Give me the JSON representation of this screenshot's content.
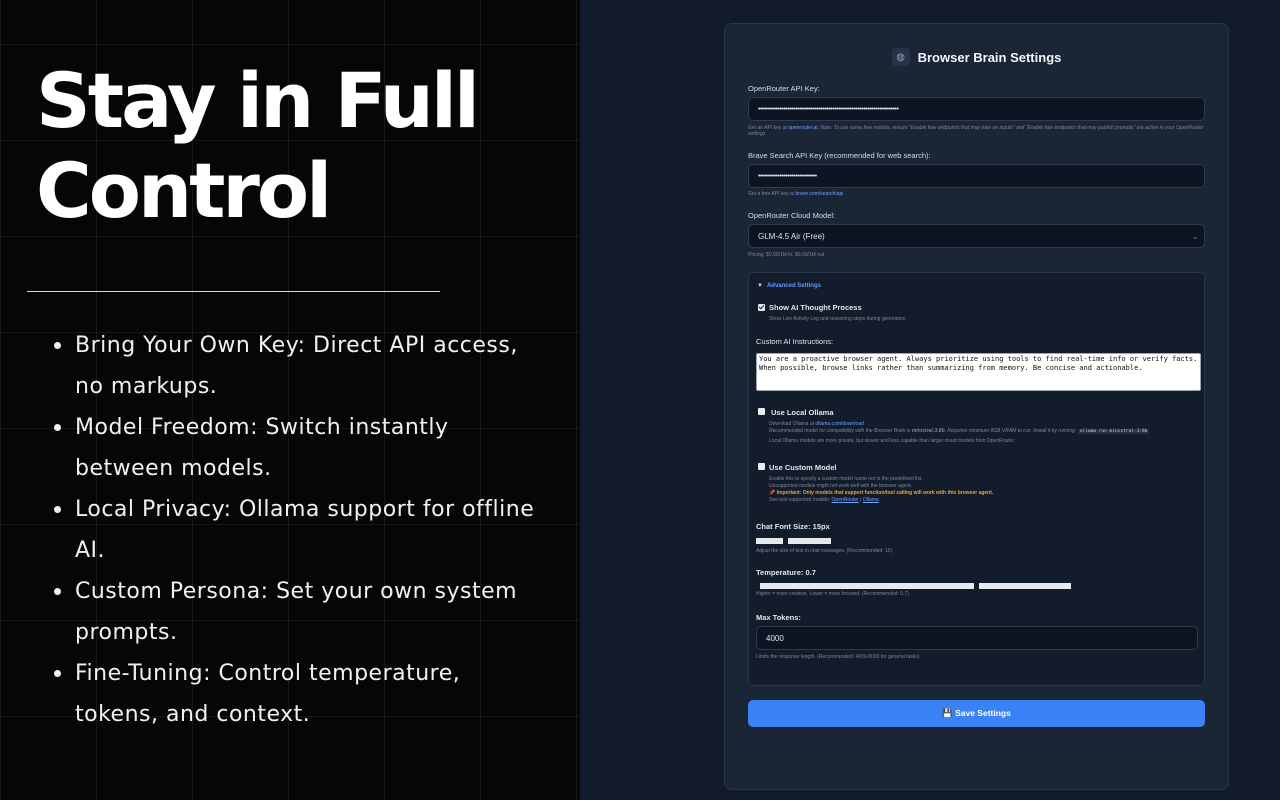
{
  "promo": {
    "headline_line1": "Stay in Full",
    "headline_line2": "Control",
    "bullets": [
      "Bring Your Own Key: Direct API access, no markups.",
      "Model Freedom: Switch instantly between models.",
      "Local Privacy: Ollama support for offline AI.",
      "Custom Persona: Set your own system prompts.",
      "Fine-Tuning: Control temperature, tokens, and context."
    ]
  },
  "settings": {
    "icon": "brain-icon",
    "title": "Browser Brain Settings",
    "openrouter_key": {
      "label": "OpenRouter API Key:",
      "value": "••••••••••••••••••••••••••••••••••••••••••••••••••••••••••••••••••••••••",
      "hint_prefix": "Get an API key at ",
      "hint_link": "openrouter.ai",
      "hint_suffix": ". Note: To use some free models, ensure \"Enable free endpoints that may train on inputs\" and \"Enable free endpoints that may publish prompts\" are active in your OpenRouter settings."
    },
    "brave_key": {
      "label": "Brave Search API Key (recommended for web search):",
      "value": "••••••••••••••••••••••••••••••",
      "hint_prefix": "Get a free API key at ",
      "hint_link": "brave.com/search/api"
    },
    "cloud_model": {
      "label": "OpenRouter Cloud Model:",
      "selected": "GLM-4.5 Air (Free)",
      "pricing": "Pricing: $0.00/1M in, $0.00/1M out"
    },
    "advanced": {
      "toggle_label": "Advanced Settings",
      "show_thought": {
        "label": "Show AI Thought Process",
        "checked": true,
        "hint": "Show Live Activity Log and reasoning steps during generation"
      },
      "custom_instructions": {
        "label": "Custom AI Instructions:",
        "value": "You are a proactive browser agent. Always prioritize using tools to find real-time info or verify facts. When possible, browse links rather than summarizing from memory. Be concise and actionable."
      },
      "local_ollama": {
        "label": "Use Local Ollama",
        "checked": false,
        "hint1_prefix": "Download Ollama at ",
        "hint1_link": "ollama.com/download",
        "hint2_prefix": "Recommended model for compatibility with the Browser Brain is ",
        "hint2_model": "ministral-3:8b",
        "hint2_middle": ". Requires minimum 8GB VRAM to run. Install it by running: ",
        "hint2_command": "ollama run ministral-3:8b",
        "hint3": "Local Ollama models are more private, but slower and less capable than larger cloud models from OpenRouter."
      },
      "custom_model": {
        "label": "Use Custom Model",
        "checked": false,
        "hint1": "Enable this to specify a custom model name not in the predefined list.",
        "hint2": "Unsupported models might not work well with the browser agent.",
        "warning": "📌 Important: Only models that support function/tool calling will work with this browser agent.",
        "hint3_prefix": "See tool-supported models: ",
        "link_openrouter": "OpenRouter",
        "separator": " | ",
        "link_ollama": "Ollama"
      },
      "font_size": {
        "label": "Chat Font Size: 15px",
        "hint": "Adjust the size of text in chat messages. (Recommended: 15)"
      },
      "temperature": {
        "label": "Temperature: 0.7",
        "hint": "Higher = more creative, Lower = more focused. (Recommended: 0.7)"
      },
      "max_tokens": {
        "label": "Max Tokens:",
        "value": "4000",
        "hint": "Limits the response length. (Recommended: 4000-8000 for general tasks)"
      }
    },
    "save_icon": "floppy-disk-icon",
    "save_label": "💾 Save Settings"
  }
}
